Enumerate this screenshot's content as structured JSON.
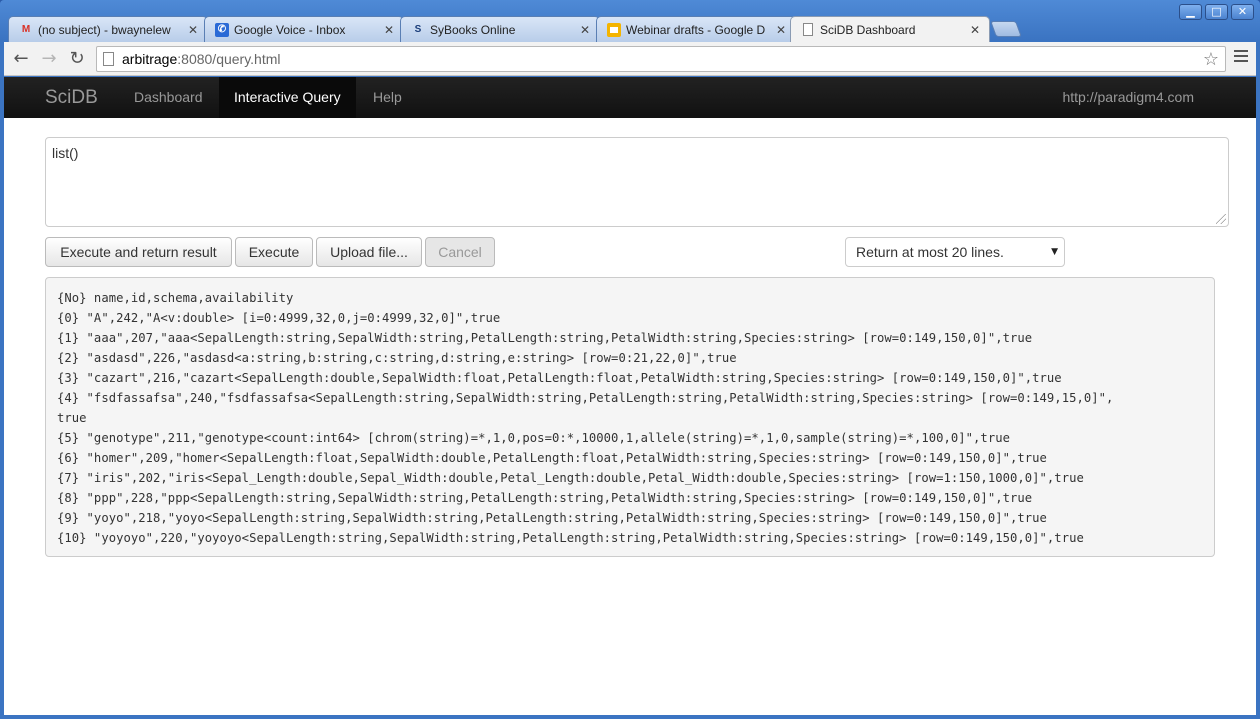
{
  "window": {
    "controls": {
      "minimize": "▁",
      "maximize": "□",
      "close": "✕"
    }
  },
  "tabs": [
    {
      "title": "(no subject) - bwaynelew",
      "icon": "gmail-icon",
      "icon_glyph": "M",
      "icon_color": "#d93025"
    },
    {
      "title": "Google Voice - Inbox",
      "icon": "phone-icon",
      "icon_glyph": "✆",
      "icon_color": "#2a6ad6"
    },
    {
      "title": "SyBooks Online",
      "icon": "book-icon",
      "icon_glyph": "S",
      "icon_color": "#1a3d7a"
    },
    {
      "title": "Webinar drafts - Google D",
      "icon": "slides-icon",
      "icon_glyph": "▭",
      "icon_color": "#f4b400"
    },
    {
      "title": "SciDB Dashboard",
      "icon": "page-icon",
      "icon_glyph": "",
      "icon_color": "#888888"
    }
  ],
  "toolbar": {
    "url_host": "arbitrage",
    "url_rest": ":8080/query.html"
  },
  "navbar": {
    "brand": "SciDB",
    "links": [
      "Dashboard",
      "Interactive Query",
      "Help"
    ],
    "active": "Interactive Query",
    "right_link": "http://paradigm4.com"
  },
  "query": {
    "value": "list()"
  },
  "buttons": {
    "execute_return": "Execute and return result",
    "execute": "Execute",
    "upload": "Upload file...",
    "cancel": "Cancel"
  },
  "limit_select": {
    "selected": "Return at most 20 lines."
  },
  "result_lines": [
    "{No} name,id,schema,availability",
    "{0} \"A\",242,\"A<v:double> [i=0:4999,32,0,j=0:4999,32,0]\",true",
    "{1} \"aaa\",207,\"aaa<SepalLength:string,SepalWidth:string,PetalLength:string,PetalWidth:string,Species:string> [row=0:149,150,0]\",true",
    "{2} \"asdasd\",226,\"asdasd<a:string,b:string,c:string,d:string,e:string> [row=0:21,22,0]\",true",
    "{3} \"cazart\",216,\"cazart<SepalLength:double,SepalWidth:float,PetalLength:float,PetalWidth:string,Species:string> [row=0:149,150,0]\",true",
    "{4} \"fsdfassafsa\",240,\"fsdfassafsa<SepalLength:string,SepalWidth:string,PetalLength:string,PetalWidth:string,Species:string> [row=0:149,15,0]\",",
    "true",
    "{5} \"genotype\",211,\"genotype<count:int64> [chrom(string)=*,1,0,pos=0:*,10000,1,allele(string)=*,1,0,sample(string)=*,100,0]\",true",
    "{6} \"homer\",209,\"homer<SepalLength:float,SepalWidth:double,PetalLength:float,PetalWidth:string,Species:string> [row=0:149,150,0]\",true",
    "{7} \"iris\",202,\"iris<Sepal_Length:double,Sepal_Width:double,Petal_Length:double,Petal_Width:double,Species:string> [row=1:150,1000,0]\",true",
    "{8} \"ppp\",228,\"ppp<SepalLength:string,SepalWidth:string,PetalLength:string,PetalWidth:string,Species:string> [row=0:149,150,0]\",true",
    "{9} \"yoyo\",218,\"yoyo<SepalLength:string,SepalWidth:string,PetalLength:string,PetalWidth:string,Species:string> [row=0:149,150,0]\",true",
    "{10} \"yoyoyo\",220,\"yoyoyo<SepalLength:string,SepalWidth:string,PetalLength:string,PetalWidth:string,Species:string> [row=0:149,150,0]\",true"
  ]
}
